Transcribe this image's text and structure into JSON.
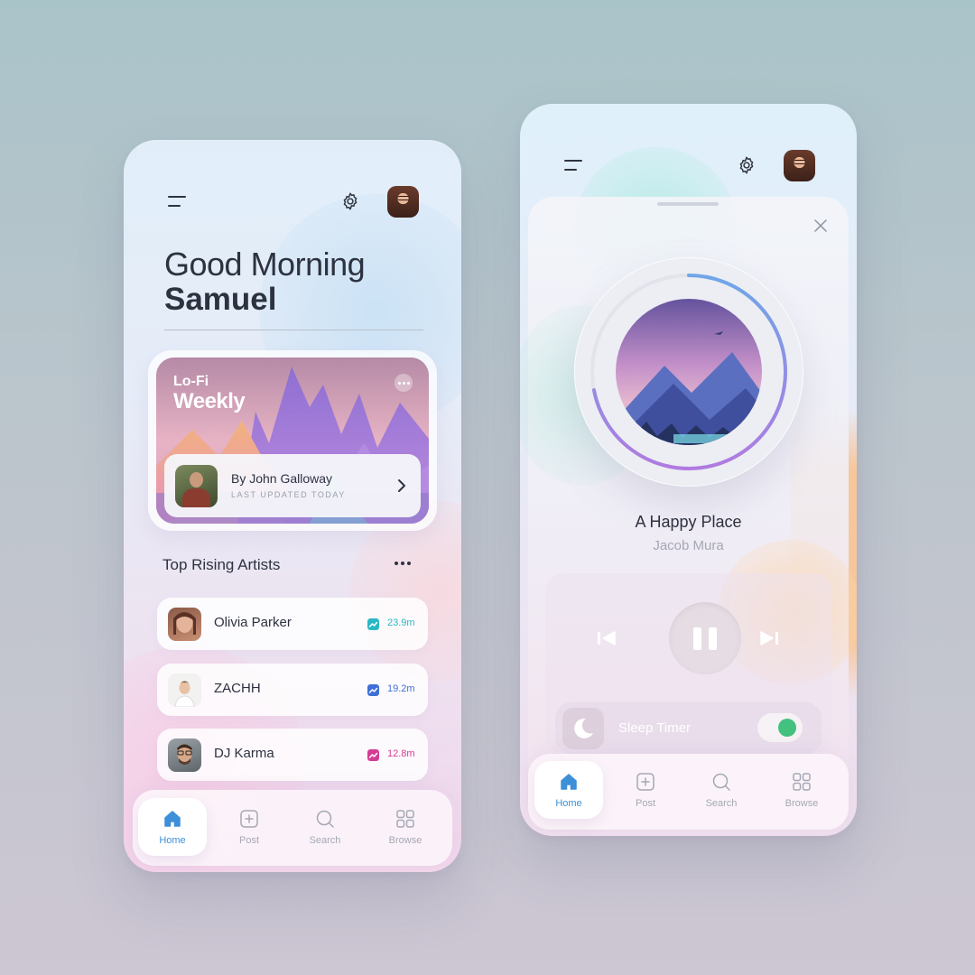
{
  "colors": {
    "accent": "#3d8fd8",
    "text_dark": "#2d3240",
    "text_muted": "#a4a8b4",
    "toggle_on": "#42c17f",
    "trend_teal": "#2bb7c4",
    "trend_blue": "#3f6fd6",
    "trend_pink": "#d43c93"
  },
  "home_screen": {
    "header": {
      "menu_icon": "menu-icon",
      "settings_icon": "gear-icon",
      "avatar": "user-avatar"
    },
    "greeting": "Good Morning",
    "user_name": "Samuel",
    "featured_playlist": {
      "title_line1": "Lo-Fi",
      "title_line2": "Weekly",
      "author": "By John Galloway",
      "updated": "LAST UPDATED TODAY"
    },
    "section_title": "Top Rising Artists",
    "artists": [
      {
        "name": "Olivia Parker",
        "count": "23.9m",
        "color": "#2bb7c4"
      },
      {
        "name": "ZACHH",
        "count": "19.2m",
        "color": "#3f6fd6"
      },
      {
        "name": "DJ Karma",
        "count": "12.8m",
        "color": "#d43c93"
      }
    ],
    "tabs": [
      {
        "label": "Home",
        "icon": "home-icon",
        "active": true
      },
      {
        "label": "Post",
        "icon": "plus-square-icon",
        "active": false
      },
      {
        "label": "Search",
        "icon": "search-icon",
        "active": false
      },
      {
        "label": "Browse",
        "icon": "grid-icon",
        "active": false
      }
    ]
  },
  "player_screen": {
    "header": {
      "menu_icon": "menu-icon",
      "settings_icon": "gear-icon",
      "avatar": "user-avatar"
    },
    "song_title": "A Happy Place",
    "song_artist": "Jacob Mura",
    "progress": 0.72,
    "playback_state": "playing",
    "sleep_timer": {
      "label": "Sleep Timer",
      "enabled": true
    },
    "tabs": [
      {
        "label": "Home",
        "icon": "home-icon",
        "active": true
      },
      {
        "label": "Post",
        "icon": "plus-square-icon",
        "active": false
      },
      {
        "label": "Search",
        "icon": "search-icon",
        "active": false
      },
      {
        "label": "Browse",
        "icon": "grid-icon",
        "active": false
      }
    ]
  }
}
